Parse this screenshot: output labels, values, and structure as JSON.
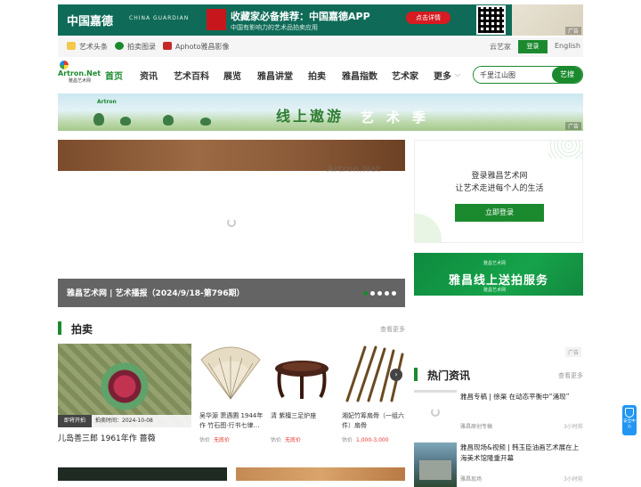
{
  "top_ad": {
    "brand": "中国嘉德",
    "brand_en": "CHINA GUARDIAN",
    "headline": "收藏家必备推荐：中国嘉德APP",
    "sub": "中国有影响力的艺术品拍卖应用",
    "cta": "点击详情",
    "tag": "广告"
  },
  "util": {
    "links": [
      "艺术头条",
      "拍卖图录",
      "Aphoto雅昌影像"
    ],
    "yun": "云艺家",
    "login": "登录",
    "english": "English"
  },
  "logo": {
    "name": "Artron.Net",
    "sub": "雅昌艺术网"
  },
  "nav": {
    "items": [
      "首页",
      "资讯",
      "艺术百科",
      "展览",
      "雅昌讲堂",
      "拍卖",
      "雅昌指数",
      "艺术家",
      "更多"
    ]
  },
  "search": {
    "value": "千里江山图",
    "button": "艺搜"
  },
  "mid_ad": {
    "logo": "Artron",
    "title": "线上遨游",
    "title2": "艺术季",
    "tag": "广告"
  },
  "carousel": {
    "watermark": "Artron.Net",
    "caption": "雅昌艺术网 | 艺术播报（2024/9/18-第796期）",
    "dots": 5
  },
  "login_card": {
    "line1": "登录雅昌艺术网",
    "line2": "让艺术走进每个人的生活",
    "button": "立即登录"
  },
  "right_ad": {
    "small": "雅昌艺术网",
    "main": "雅昌线上送拍服务",
    "foot": "雅昌艺术网",
    "tag": "广告"
  },
  "auction": {
    "title": "拍卖",
    "more": "查看更多",
    "feature": {
      "badge": "即将开拍",
      "time": "拍卖时间：2024-10-08",
      "title": "儿岛善三郎 1961年作 蔷薇"
    },
    "items": [
      {
        "name": "吴华源 萧遇圃 1944年作 竹石图·行书七律…",
        "est_label": "估价",
        "est": "无底价"
      },
      {
        "name": "清 紫檀三足炉座",
        "est_label": "估价",
        "est": "无底价"
      },
      {
        "name": "湘妃竹筹扇骨（一组六件）扇骨",
        "est_label": "估价",
        "est": "1,000-3,000"
      }
    ]
  },
  "hot": {
    "title": "热门资讯",
    "more": "查看更多",
    "news": [
      {
        "title": "雅昌专稿 | 徐渠 在动态平衡中“涌现”",
        "src": "雅昌原创专稿",
        "time": "3小时前"
      },
      {
        "title": "雅昌现场&视频 | 韩玉臣油画艺术展在上海美术馆隆重开幕",
        "src": "雅昌现场",
        "time": "3小时前"
      }
    ]
  },
  "safety": {
    "label": "安全中心"
  },
  "colors": {
    "accent": "#1b8a2e",
    "price": "#e53935",
    "top_ad_bg": "#0f6b58"
  }
}
